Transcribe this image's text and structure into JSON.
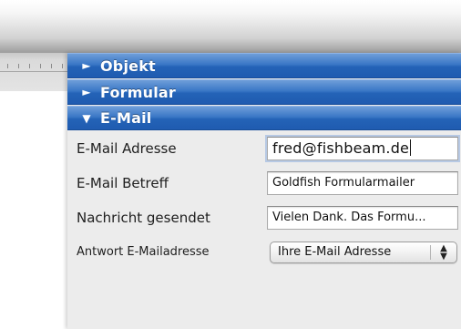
{
  "sections": {
    "objekt": {
      "label": "Objekt",
      "arrow": "►",
      "expanded": false
    },
    "formular": {
      "label": "Formular",
      "arrow": "►",
      "expanded": false
    },
    "email": {
      "label": "E-Mail",
      "arrow": "▼",
      "expanded": true
    }
  },
  "email_fields": {
    "address": {
      "label": "E-Mail Adresse",
      "value": "fred@fishbeam.de"
    },
    "subject": {
      "label": "E-Mail Betreff",
      "value": "Goldfish Formularmailer"
    },
    "sent_message": {
      "label": "Nachricht gesendet",
      "value": "Vielen Dank. Das Formu..."
    },
    "reply_address": {
      "label": "Antwort E-Mailadresse",
      "selected": "Ihre E-Mail Adresse",
      "stepper_up": "▲",
      "stepper_down": "▼"
    }
  },
  "colors": {
    "section_header": "#2463b7",
    "panel_bg": "#ececec"
  }
}
